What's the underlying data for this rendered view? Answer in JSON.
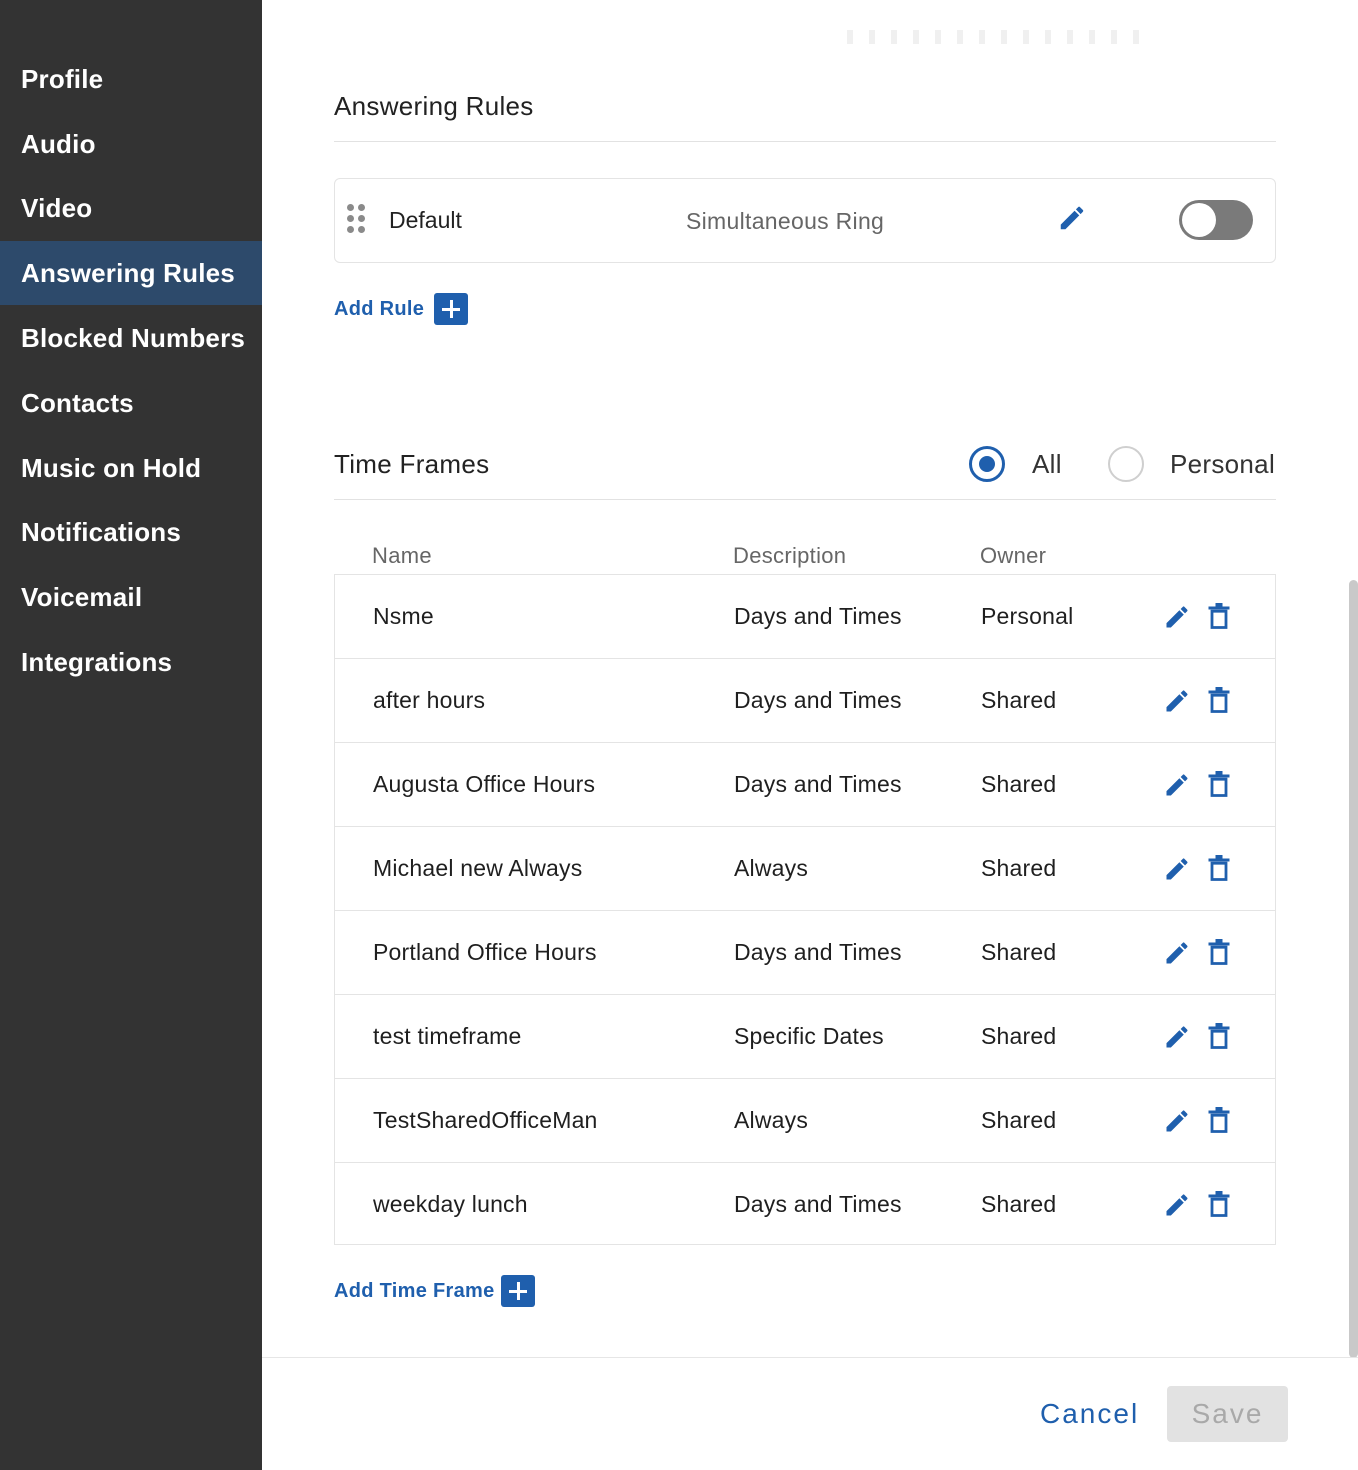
{
  "sidebar": {
    "items": [
      {
        "label": "Profile"
      },
      {
        "label": "Audio"
      },
      {
        "label": "Video"
      },
      {
        "label": "Answering Rules",
        "active": true
      },
      {
        "label": "Blocked Numbers"
      },
      {
        "label": "Contacts"
      },
      {
        "label": "Music on Hold"
      },
      {
        "label": "Notifications"
      },
      {
        "label": "Voicemail"
      },
      {
        "label": "Integrations"
      }
    ]
  },
  "answering_rules": {
    "title": "Answering Rules",
    "rules": [
      {
        "name": "Default",
        "type": "Simultaneous Ring",
        "enabled": false
      }
    ],
    "add_label": "Add Rule"
  },
  "time_frames": {
    "title": "Time Frames",
    "filter": {
      "options": [
        "All",
        "Personal"
      ],
      "selected": "All"
    },
    "columns": [
      "Name",
      "Description",
      "Owner"
    ],
    "rows": [
      {
        "name": "Nsme",
        "description": "Days and Times",
        "owner": "Personal"
      },
      {
        "name": "after hours",
        "description": "Days and Times",
        "owner": "Shared"
      },
      {
        "name": "Augusta Office Hours",
        "description": "Days and Times",
        "owner": "Shared"
      },
      {
        "name": "Michael new Always",
        "description": "Always",
        "owner": "Shared"
      },
      {
        "name": "Portland Office Hours",
        "description": "Days and Times",
        "owner": "Shared"
      },
      {
        "name": "test timeframe",
        "description": "Specific Dates",
        "owner": "Shared"
      },
      {
        "name": "TestSharedOfficeMan",
        "description": "Always",
        "owner": "Shared"
      },
      {
        "name": "weekday lunch",
        "description": "Days and Times",
        "owner": "Shared"
      }
    ],
    "add_label": "Add Time Frame"
  },
  "footer": {
    "cancel_label": "Cancel",
    "save_label": "Save"
  },
  "colors": {
    "sidebar_bg": "#333333",
    "sidebar_active": "#2d4a6b",
    "accent": "#1f5fad"
  }
}
